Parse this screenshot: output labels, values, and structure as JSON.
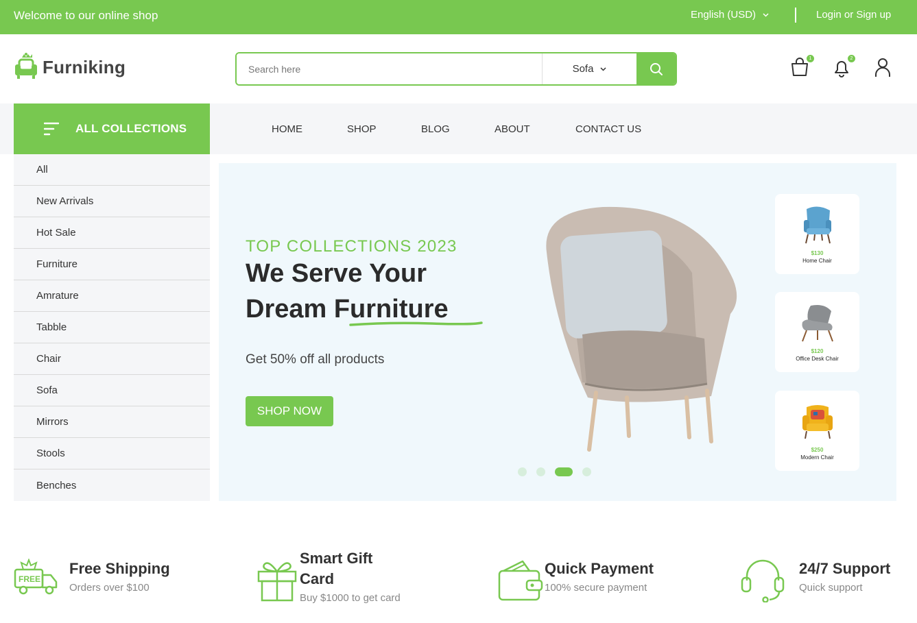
{
  "topbar": {
    "welcome": "Welcome to our online shop",
    "language": "English (USD)",
    "login": "Login or Sign up"
  },
  "header": {
    "logo_text": "Furniking",
    "search_placeholder": "Search here",
    "category_selected": "Sofa",
    "cart_count": "1",
    "notification_count": "2"
  },
  "nav": {
    "all_collections": "ALL COLLECTIONS",
    "items": [
      "HOME",
      "SHOP",
      "BLOG",
      "ABOUT",
      "CONTACT US"
    ]
  },
  "sidebar": {
    "items": [
      "All",
      "New Arrivals",
      "Hot Sale",
      "Furniture",
      "Amrature",
      "Tabble",
      "Chair",
      "Sofa",
      "Mirrors",
      "Stools",
      "Benches"
    ]
  },
  "hero": {
    "kicker": "TOP COLLECTIONS 2023",
    "headline_line1": "We Serve Your",
    "headline_line2": "Dream Furniture",
    "subtext": "Get 50% off all products",
    "cta": "SHOP NOW",
    "slides_total": 4,
    "slide_active_index": 3,
    "products": [
      {
        "price": "$130",
        "name": "Home Chair",
        "icon": "blue-armchair"
      },
      {
        "price": "$120",
        "name": "Office Desk Chair",
        "icon": "grey-lounge-chair"
      },
      {
        "price": "$250",
        "name": "Modern Chair",
        "icon": "yellow-armchair"
      }
    ]
  },
  "features": [
    {
      "title": "Free Shipping",
      "subtitle": "Orders over $100",
      "icon": "truck-icon"
    },
    {
      "title": "Smart Gift",
      "title2": "Card",
      "subtitle": "Buy $1000 to get card",
      "icon": "gift-icon"
    },
    {
      "title": "Quick Payment",
      "subtitle": "100% secure payment",
      "icon": "wallet-icon"
    },
    {
      "title": "24/7 Support",
      "subtitle": "Quick support",
      "icon": "headset-icon"
    }
  ],
  "colors": {
    "brand_green": "#78c850",
    "hero_bg": "#f0f8fc",
    "sidebar_bg": "#f5f6f8"
  }
}
